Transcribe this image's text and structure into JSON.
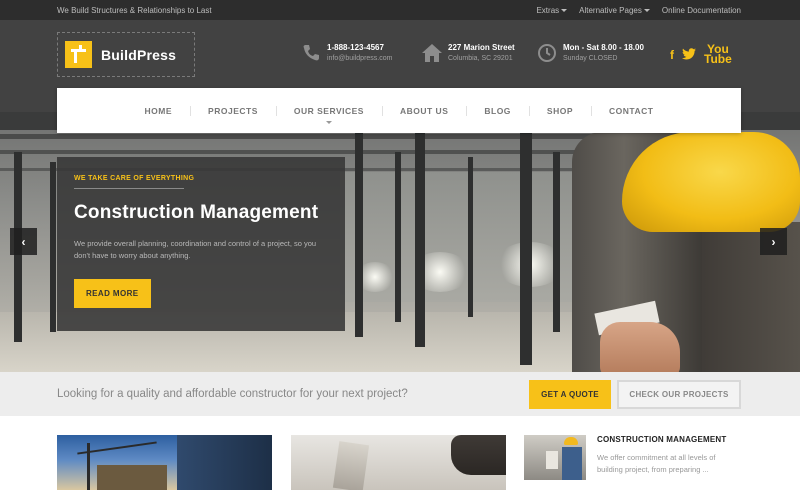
{
  "topbar": {
    "tagline": "We Build Structures & Relationships to Last",
    "links": [
      "Extras",
      "Alternative Pages",
      "Online Documentation"
    ]
  },
  "brand": {
    "name": "BuildPress",
    "accent": "#f7c118"
  },
  "contact": {
    "phone": "1-888-123-4567",
    "email": "info@buildpress.com",
    "address_line1": "227 Marion Street",
    "address_line2": "Columbia, SC 29201",
    "hours_line1": "Mon - Sat 8.00 - 18.00",
    "hours_line2": "Sunday CLOSED"
  },
  "social": {
    "facebook": "f",
    "twitter": "twitter-icon",
    "youtube_line1": "You",
    "youtube_line2": "Tube"
  },
  "nav": [
    "HOME",
    "PROJECTS",
    "OUR SERVICES",
    "ABOUT US",
    "BLOG",
    "SHOP",
    "CONTACT"
  ],
  "hero": {
    "kicker": "WE TAKE CARE OF EVERYTHING",
    "title": "Construction Management",
    "text": "We provide overall planning, coordination and control of a project, so you don't have to worry about anything.",
    "button": "READ MORE",
    "prev": "‹",
    "next": "›"
  },
  "cta": {
    "message": "Looking for a quality and affordable constructor for your next project?",
    "quote_button": "GET A QUOTE",
    "projects_button": "CHECK OUR PROJECTS"
  },
  "service": {
    "title": "CONSTRUCTION MANAGEMENT",
    "text": "We offer commitment at all levels of building project, from preparing ..."
  }
}
